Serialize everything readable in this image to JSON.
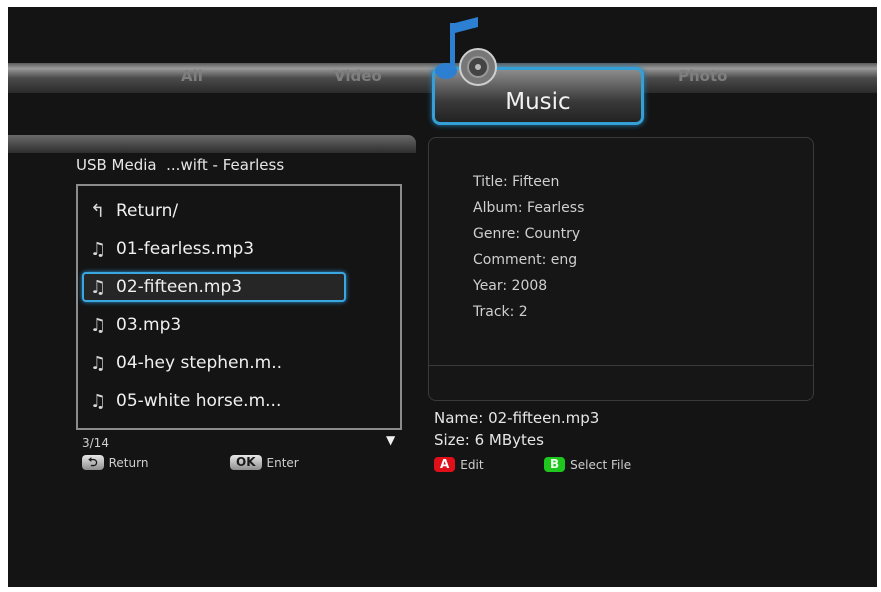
{
  "tabs": {
    "all": "All",
    "video": "Video",
    "music": "Music",
    "photo": "Photo"
  },
  "browser": {
    "breadcrumb": "USB Media  ...wift - Fearless",
    "items": [
      {
        "label": "Return/",
        "icon": "return-arrow-icon"
      },
      {
        "label": "01-fearless.mp3",
        "icon": "music-note-icon"
      },
      {
        "label": "02-fifteen.mp3",
        "icon": "music-note-icon",
        "selected": true
      },
      {
        "label": "03.mp3",
        "icon": "music-note-icon"
      },
      {
        "label": "04-hey stephen.m..",
        "icon": "music-note-icon"
      },
      {
        "label": "05-white horse.m...",
        "icon": "music-note-icon"
      }
    ],
    "counter": "3/14",
    "hints": {
      "return_key": "⮌",
      "return_label": "Return",
      "ok_key": "OK",
      "ok_label": "Enter"
    }
  },
  "info": {
    "title": "Title: Fifteen",
    "album": "Album: Fearless",
    "genre": "Genre: Country",
    "comment": "Comment: eng",
    "year": "Year: 2008",
    "track": "Track: 2",
    "name": "Name: 02-fifteen.mp3",
    "size": "Size: 6 MBytes"
  },
  "actions": {
    "a_key": "A",
    "a_label": "Edit",
    "b_key": "B",
    "b_label": "Select File"
  },
  "colors": {
    "accent": "#35a0d6",
    "red_key": "#e0101a",
    "green_key": "#1ec61e",
    "background": "#141414"
  }
}
